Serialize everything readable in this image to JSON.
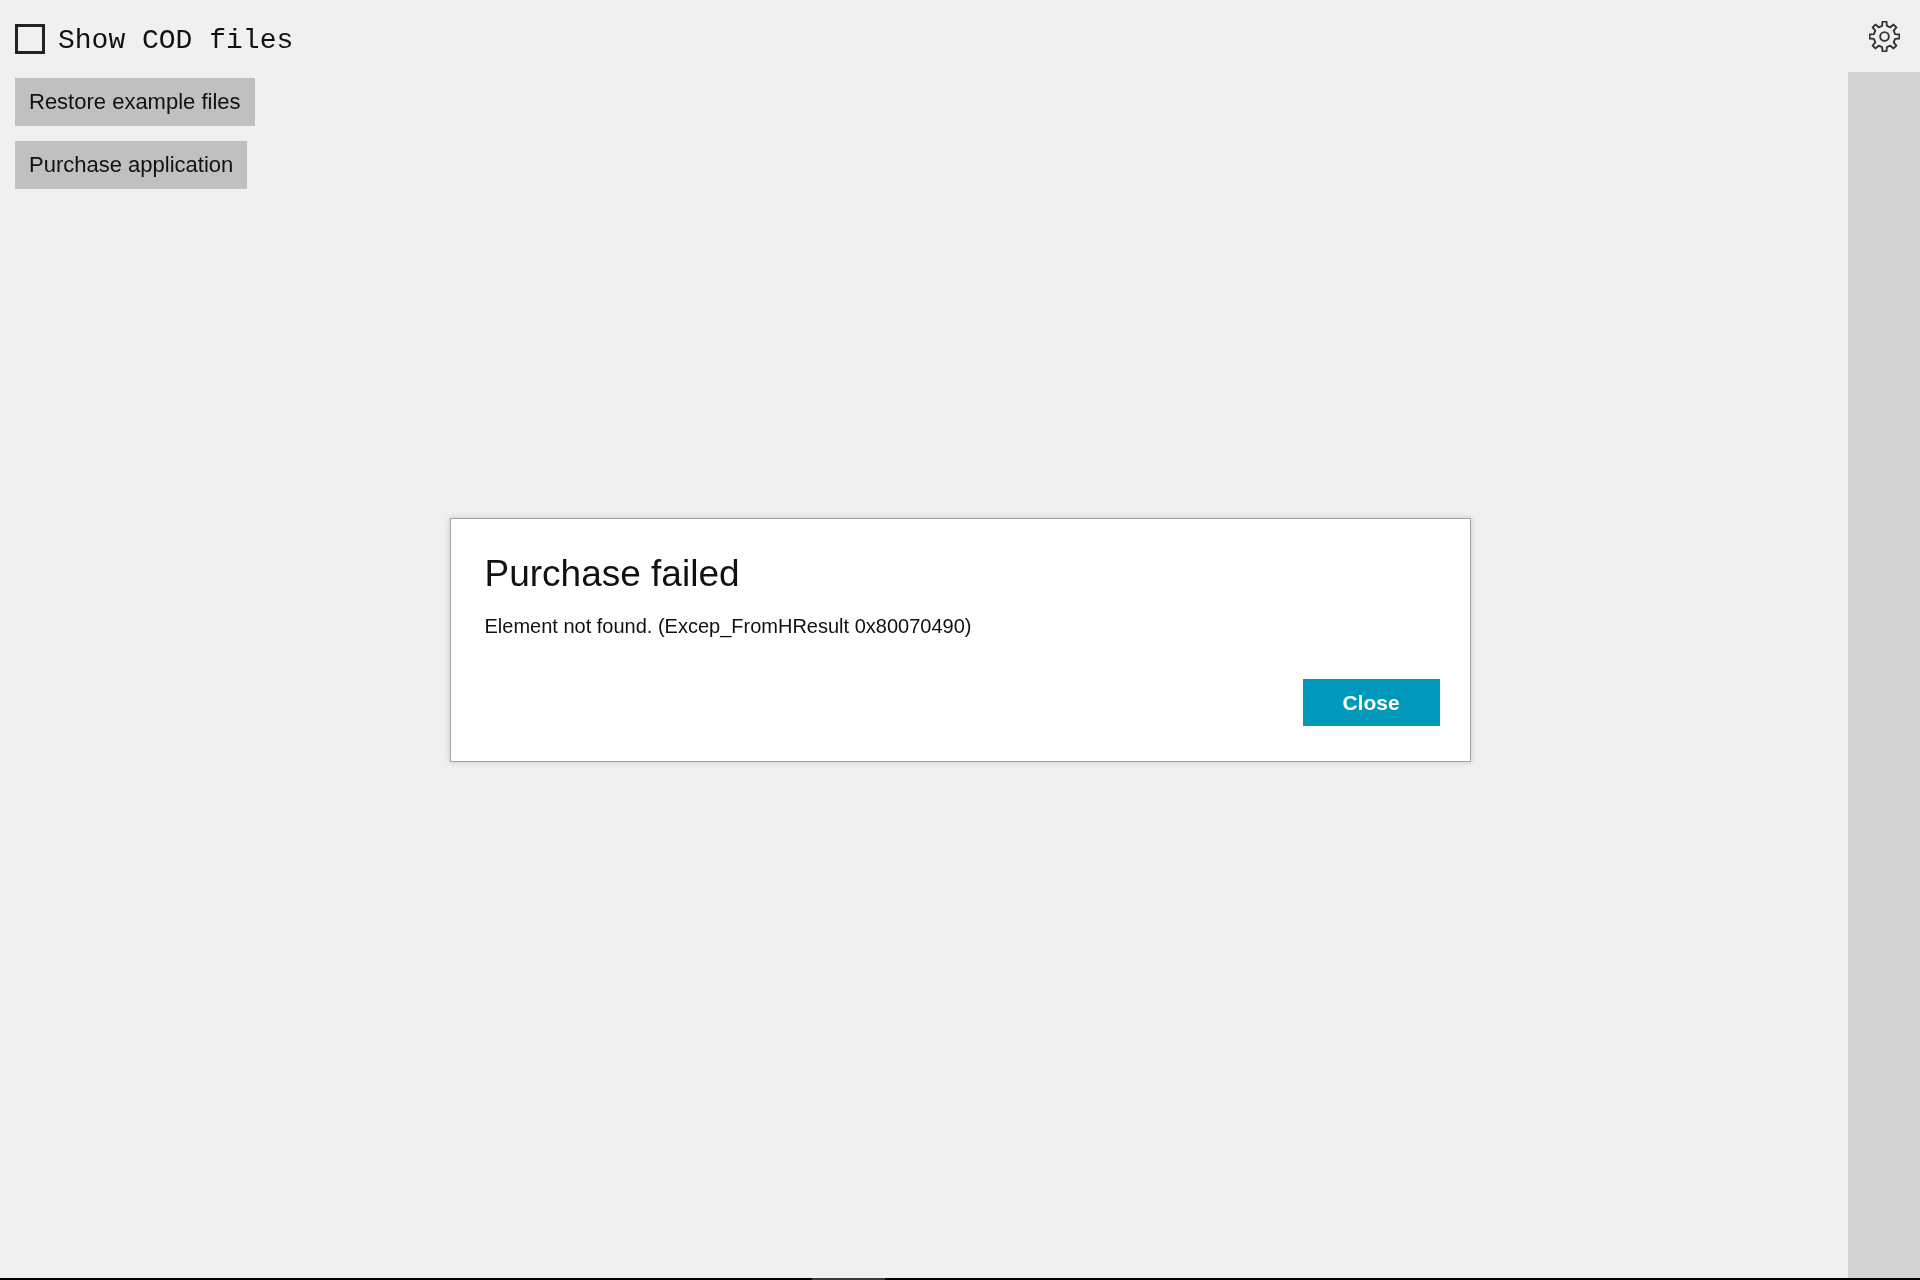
{
  "show_cod_files": {
    "label": "Show COD files",
    "checked": false
  },
  "buttons": [
    "Restore example files",
    "Purchase application"
  ],
  "dialog": {
    "title": "Purchase failed",
    "message": "Element not found. (Excep_FromHResult 0x80070490)",
    "buttons": [
      "Close"
    ]
  }
}
